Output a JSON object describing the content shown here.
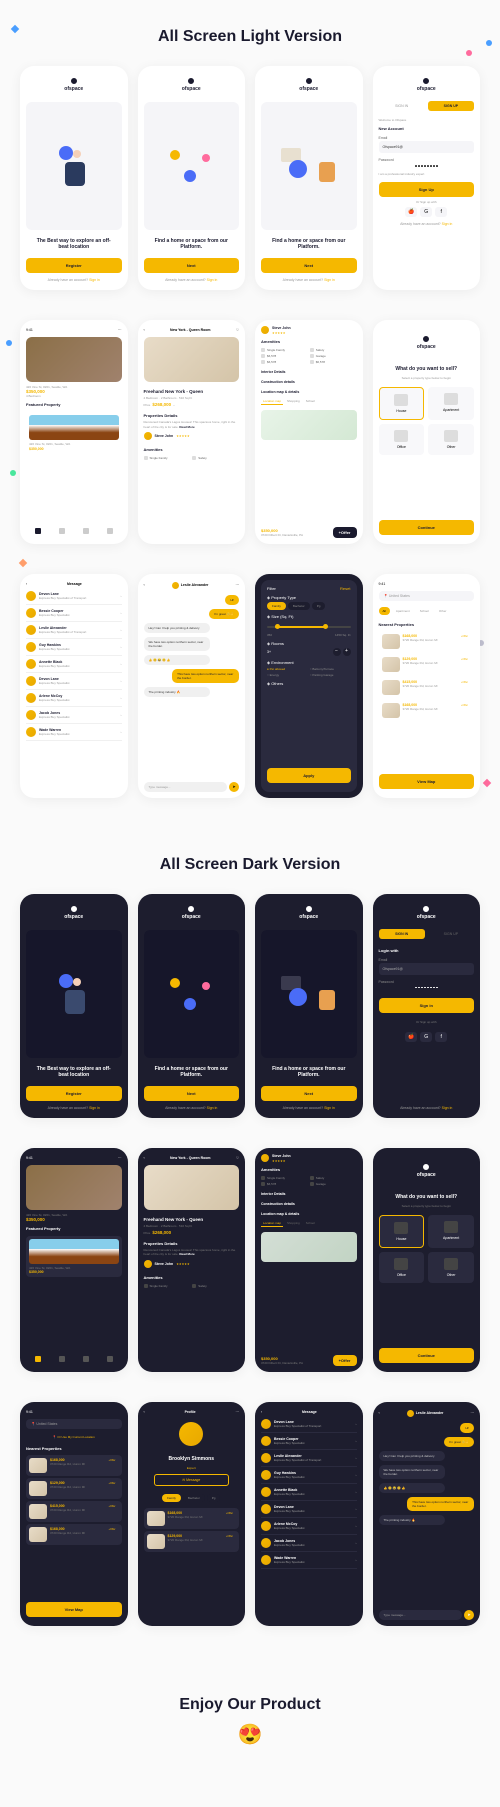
{
  "sections": {
    "light": "All Screen Light Version",
    "dark": "All Screen Dark Version",
    "enjoy": "Enjoy Our Product"
  },
  "brand": "ofspace",
  "onboard": {
    "h1": "The Best way to explore an off-beat location",
    "h2": "Find a home or space from our Platform.",
    "register": "Register",
    "next": "Next",
    "already": "Already have an account?",
    "signin": "Sign in"
  },
  "signup": {
    "tab_signin": "SIGN IN",
    "tab_signup": "SIGN UP",
    "title": "New Account",
    "login_title": "Login with",
    "email": "Email",
    "email_val": "Ofspace91@",
    "password": "Password",
    "checkbox": "I am a professional industry expert",
    "btn": "Sign Up",
    "signin_btn": "Sign in",
    "or": "Or Sign up with"
  },
  "home": {
    "addr": "426 Vine St, #201, Seattle, WA",
    "price": "$350,000",
    "featured": "Featured Property",
    "beds": "4 Bedroom"
  },
  "detail": {
    "title": "New York - Queen Room",
    "name": "Freehand New York - Queen",
    "beds": "4 Bedroom",
    "baths": "2 Bathroom",
    "area": "510 Sq Ft",
    "price_label": "Price",
    "price": "$268,000",
    "separator": "–",
    "desc_h": "Properties Details",
    "desc": "Renowned Canada's Lagos Houses! This spacious home, right in the heart of the city is for sale.",
    "readmore": "Read More",
    "reviewer": "Steve John",
    "amenities": "Amenities"
  },
  "amenities": {
    "h": "Amenities",
    "items": [
      "Single Family",
      "Safety",
      "$6,578",
      "Garage",
      "$6,578",
      "$6,578"
    ],
    "interior": "Interior Details",
    "construction": "Construction details",
    "location_h": "Location map & details",
    "tabs": [
      "Location map",
      "Shopping",
      "School"
    ],
    "price": "$350,000",
    "addr": "3720 Filbert Dr, Danielsville, PA",
    "offer": "+Offer"
  },
  "sell": {
    "q": "What do you want to sell?",
    "sub": "Select a property type below to begin",
    "opts": [
      "House",
      "Apartment",
      "Office",
      "Other"
    ],
    "btn": "Continue"
  },
  "messages": {
    "title": "Message",
    "list": [
      {
        "n": "Devon Lane",
        "s": "Express Buy Specialist of Transport"
      },
      {
        "n": "Bessie Cooper",
        "s": "Express Buy Specialist"
      },
      {
        "n": "Leslie Alexander",
        "s": "Express Buy Specialist of Transport"
      },
      {
        "n": "Guy Hawkins",
        "s": "Express Buy Specialist"
      },
      {
        "n": "Annette Black",
        "s": "Express Buy Specialist"
      },
      {
        "n": "Devon Lane",
        "s": "Express Buy Specialist"
      },
      {
        "n": "Arlene McCoy",
        "s": "Express Buy Specialist"
      },
      {
        "n": "Jacob Jones",
        "s": "Express Buy Specialist"
      },
      {
        "n": "Wade Warren",
        "s": "Express Buy Specialist"
      }
    ]
  },
  "chat": {
    "name": "Leslie Alexander",
    "bubbles": [
      {
        "t": "Hi!",
        "s": true
      },
      {
        "t": "I'm great 😊👋",
        "s": true
      },
      {
        "t": "Hey! Can I help you printing & delivery",
        "s": false
      },
      {
        "t": "We have two option northern sector, near the border.",
        "s": false
      },
      {
        "t": "👍 😊 😂 😊 👍",
        "s": false
      },
      {
        "t": "This have two option northern sector, near the border.",
        "s": true
      },
      {
        "t": "The printing industry 🔥",
        "s": false
      },
      {
        "t": "We have two option northern sector, near the border.",
        "s": false
      }
    ],
    "placeholder": "Type message..."
  },
  "filter": {
    "title": "Filter",
    "reset": "Reset",
    "type": "Property Type",
    "types": [
      "Family",
      "Bachelor",
      "Pg"
    ],
    "size": "Size (Sq. Ft)",
    "size_min": "350",
    "size_max": "1450 Sq. Ft",
    "rooms": "Rooms",
    "rooms_val": "3+",
    "env": "Environment",
    "env_opts": [
      "Pet allowed",
      "Balcony/Terrace",
      "Energy",
      "Parking Garage"
    ],
    "others": "Others",
    "apply": "Apply"
  },
  "search": {
    "bar": "United States",
    "loc_btn": "Or Use My Current Location",
    "pills": [
      "All",
      "Apartment",
      "School",
      "Other"
    ],
    "nearest": "Nearest Properties",
    "cards": [
      {
        "p": "$168,000",
        "a": "3720 Range Rd, Huron MI",
        "b": "+Offer"
      },
      {
        "p": "$129,000",
        "a": "3720 Range Rd, Huron MI",
        "b": "+Offer"
      },
      {
        "p": "$415,000",
        "a": "3720 Range Rd, Huron MI",
        "b": "+Offer"
      },
      {
        "p": "$168,000",
        "a": "3720 Range Rd, Huron MI",
        "b": "+Offer"
      }
    ],
    "viewmap": "View Map"
  },
  "profile": {
    "title": "Profile",
    "name": "Brooklyn Simmons",
    "role": "Expert",
    "msg_btn": "Message",
    "tabs": [
      "Family",
      "Bachelor",
      "Pg"
    ]
  }
}
